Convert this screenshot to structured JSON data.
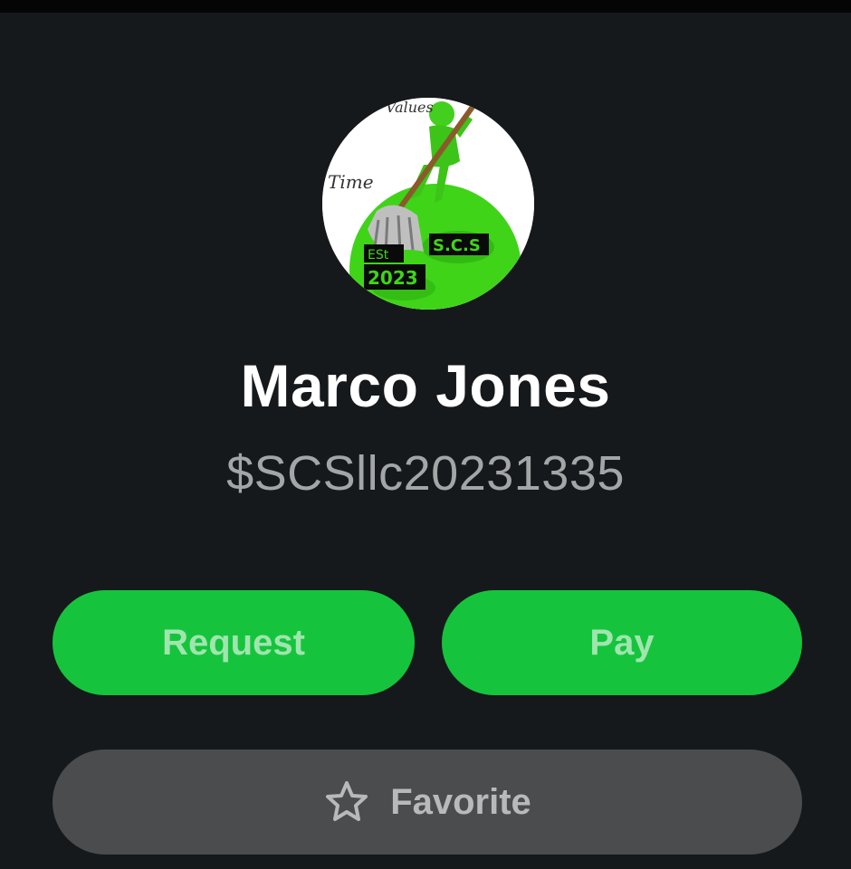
{
  "profile": {
    "name": "Marco Jones",
    "cashtag": "$SCSllc20231335",
    "avatar": {
      "icon": "cleaning-mascot-logo",
      "logo_text": [
        "Values",
        "Time",
        "S.C.S",
        "ESt",
        "2023"
      ]
    }
  },
  "actions": {
    "request_label": "Request",
    "pay_label": "Pay",
    "favorite_label": "Favorite",
    "favorite_icon": "star-outline-icon"
  },
  "colors": {
    "background": "#16191b",
    "accent_green": "#15c43c",
    "favorite_button": "#4a4c4e"
  }
}
